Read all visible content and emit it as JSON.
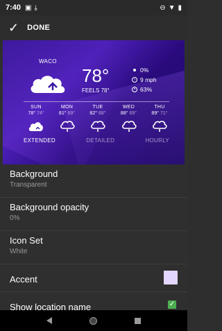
{
  "status_bar": {
    "time": "7:40",
    "left_icons": [
      "image-icon",
      "download-icon"
    ],
    "right_icons": [
      "do-not-disturb-icon",
      "wifi-icon",
      "battery-icon"
    ]
  },
  "toolbar": {
    "done_label": "DONE"
  },
  "widget": {
    "city": "WACO",
    "temperature": "78°",
    "feels_like": "FEELS 78°",
    "precip": "0%",
    "wind": "9 mph",
    "humidity": "63%",
    "forecast": [
      {
        "day": "SUN",
        "hi": "78°",
        "lo": "74°",
        "icon": "partly-cloudy-icon"
      },
      {
        "day": "MON",
        "hi": "81°",
        "lo": "69°",
        "icon": "rain-cloud-icon"
      },
      {
        "day": "TUE",
        "hi": "82°",
        "lo": "68°",
        "icon": "rain-cloud-icon"
      },
      {
        "day": "WED",
        "hi": "88°",
        "lo": "69°",
        "icon": "rain-cloud-icon"
      },
      {
        "day": "THU",
        "hi": "89°",
        "lo": "71°",
        "icon": "rain-cloud-icon"
      }
    ],
    "links": {
      "extended": "EXTENDED",
      "detailed": "DETAILED",
      "hourly": "HOURLY"
    }
  },
  "settings": {
    "background": {
      "title": "Background",
      "value": "Transparent"
    },
    "background_opacity": {
      "title": "Background opacity",
      "value": "0%"
    },
    "icon_set": {
      "title": "Icon Set",
      "value": "White"
    },
    "accent": {
      "title": "Accent",
      "color": "#e3d6ff"
    },
    "show_location": {
      "title": "Show location name",
      "checked": true
    }
  },
  "colors": {
    "widget_bg": "#3a17a3",
    "checkbox_green": "#4caf50"
  }
}
